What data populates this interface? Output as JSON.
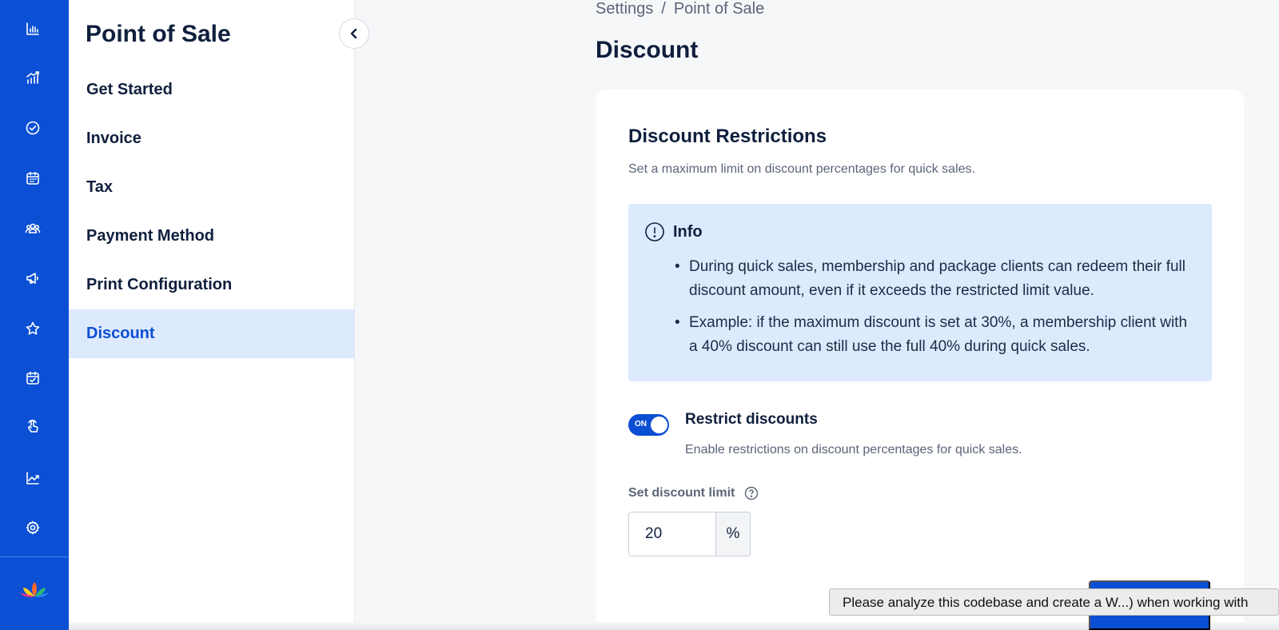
{
  "rail": {
    "accent": "#0a4fd4",
    "icons": [
      "bar-chart-icon",
      "growth-chart-icon",
      "check-circle-icon",
      "calendar-icon",
      "users-icon",
      "megaphone-icon",
      "star-icon",
      "calendar-check-icon",
      "hand-pointer-icon",
      "trend-line-icon",
      "gear-icon"
    ],
    "logo": "lotus-logo"
  },
  "sidemenu": {
    "title": "Point of Sale",
    "items": [
      {
        "label": "Get Started",
        "active": false
      },
      {
        "label": "Invoice",
        "active": false
      },
      {
        "label": "Tax",
        "active": false
      },
      {
        "label": "Payment Method",
        "active": false
      },
      {
        "label": "Print Configuration",
        "active": false
      },
      {
        "label": "Discount",
        "active": true
      }
    ],
    "collapse_icon": "chevron-left-icon"
  },
  "breadcrumb": {
    "parent": "Settings",
    "separator": "/",
    "current": "Point of Sale"
  },
  "page": {
    "title": "Discount"
  },
  "card": {
    "title": "Discount Restrictions",
    "subtitle": "Set a maximum limit on discount percentages for quick sales.",
    "info": {
      "icon": "exclamation-circle-icon",
      "title": "Info",
      "bullets": [
        "During quick sales, membership and package clients can redeem their full discount amount, even if it exceeds the restricted limit value.",
        "Example: if the maximum discount is set at 30%, a membership client with a 40% discount can still use the full 40% during quick sales."
      ]
    },
    "restrict": {
      "toggle_label": "ON",
      "enabled": true,
      "title": "Restrict discounts",
      "subtitle": "Enable restrictions on discount percentages for quick sales."
    },
    "limit": {
      "label": "Set discount limit",
      "help_icon": "question-circle-icon",
      "value": "20",
      "unit": "%"
    }
  },
  "tooltip": {
    "text": "Please analyze this codebase and create a W...) when working with"
  }
}
